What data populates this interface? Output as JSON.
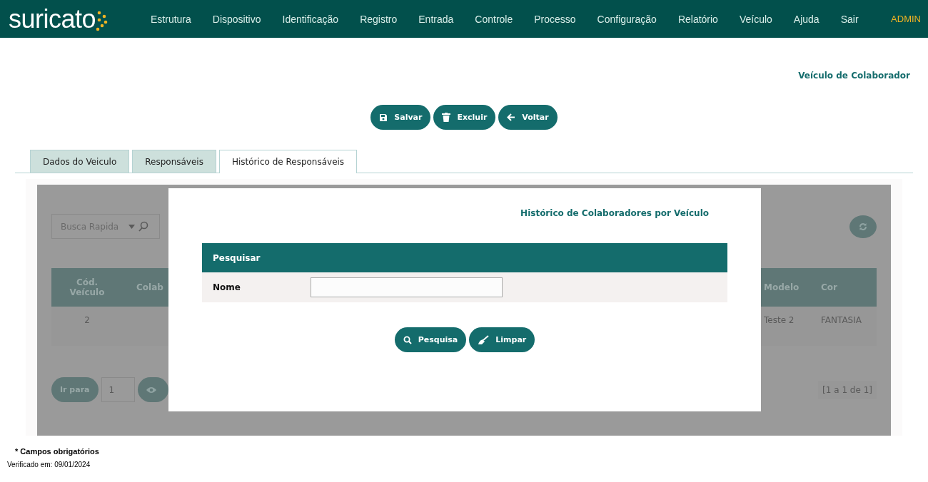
{
  "brand": "suricato",
  "nav": [
    {
      "label": "Estrutura"
    },
    {
      "label": "Dispositivo"
    },
    {
      "label": "Identificação"
    },
    {
      "label": "Registro"
    },
    {
      "label": "Entrada"
    },
    {
      "label": "Controle"
    },
    {
      "label": "Processo"
    },
    {
      "label": "Configuração"
    },
    {
      "label": "Relatório"
    },
    {
      "label": "Veículo"
    },
    {
      "label": "Ajuda"
    },
    {
      "label": "Sair"
    }
  ],
  "user": "ADMIN",
  "page_title": "Veículo de Colaborador",
  "actions": [
    {
      "kind": "save",
      "label": "Salvar"
    },
    {
      "kind": "delete",
      "label": "Excluir"
    },
    {
      "kind": "back",
      "label": "Voltar"
    }
  ],
  "tabs": [
    {
      "label": "Dados do Veiculo",
      "selected": false
    },
    {
      "label": "Responsáveis",
      "selected": false
    },
    {
      "label": "Histórico de Responsáveis",
      "selected": true
    }
  ],
  "quick_search": {
    "placeholder": "Busca Rapida"
  },
  "table": {
    "columns": [
      "Cód. Veículo",
      "Colab",
      "Modelo",
      "Cor"
    ],
    "rows": [
      [
        "2",
        "",
        "Teste 2",
        "FANTASIA"
      ]
    ]
  },
  "pager": {
    "goto": "Ir para",
    "page": "1",
    "summary": "[1 a 1 de 1]"
  },
  "modal": {
    "title": "Histórico de Colaboradores por Veículo",
    "section": "Pesquisar",
    "field_label": "Nome",
    "buttons": [
      {
        "kind": "search",
        "label": "Pesquisa"
      },
      {
        "kind": "clear",
        "label": "Limpar"
      }
    ]
  },
  "footer": {
    "required_note": "* Campos obrigatórios",
    "verified": "Verificado em: 09/01/2024"
  }
}
